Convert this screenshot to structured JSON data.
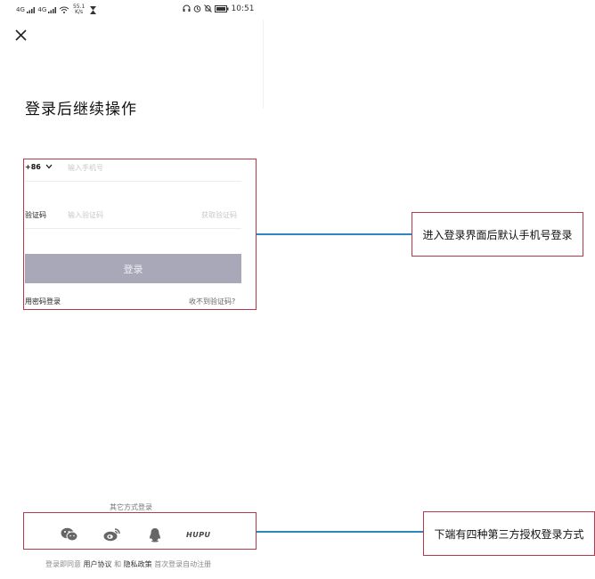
{
  "status_bar": {
    "signal_1": "4G",
    "signal_2": "4G",
    "net_speed_value": "55.1",
    "net_speed_unit": "K/s",
    "time": "10:51"
  },
  "page": {
    "title": "登录后继续操作"
  },
  "form": {
    "country_code": "+86",
    "phone_placeholder": "输入手机号",
    "code_label": "验证码",
    "code_placeholder": "输入验证码",
    "get_code": "获取验证码",
    "login_button": "登录",
    "password_login": "用密码登录",
    "no_code": "收不到验证码?"
  },
  "annotations": {
    "form_note": "进入登录界面后默认手机号登录",
    "social_note": "下端有四种第三方授权登录方式"
  },
  "social": {
    "label": "其它方式登录",
    "icons": [
      "wechat-icon",
      "weibo-icon",
      "qq-icon",
      "hupu-icon"
    ],
    "hupu_text": "HUPU"
  },
  "agreement": {
    "prefix": "登录即同意",
    "user_agreement": "用户协议",
    "and": "和",
    "privacy_policy": "隐私政策",
    "suffix": "首次登录自动注册"
  },
  "colors": {
    "annotation_border": "#b23a4a",
    "connector": "#2e86c1",
    "login_button": "#a8a8b8"
  }
}
